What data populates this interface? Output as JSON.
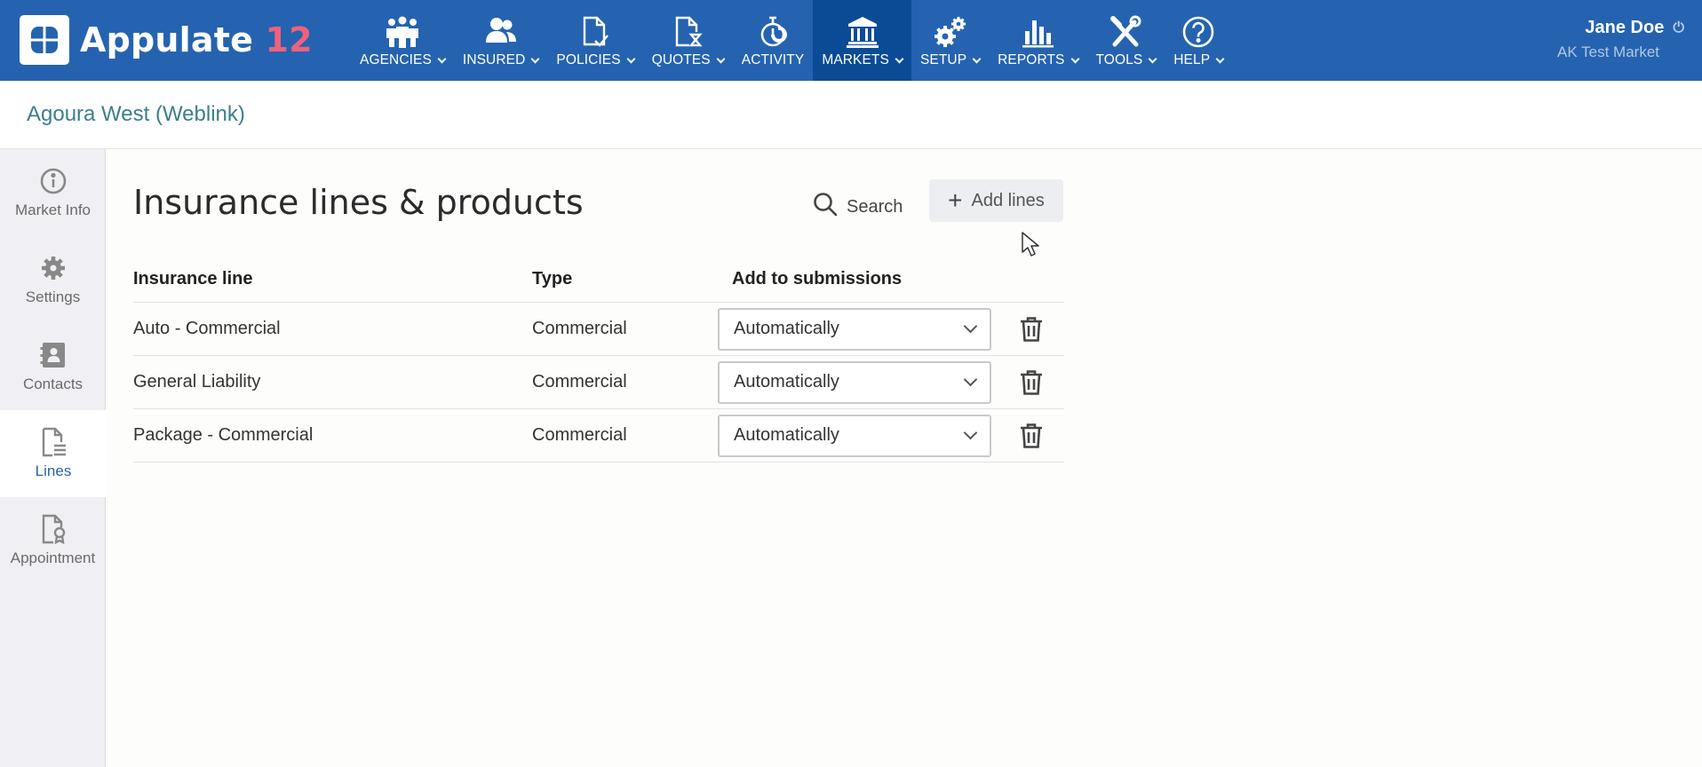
{
  "app": {
    "name": "Appulate",
    "version": "12"
  },
  "nav": {
    "items": [
      {
        "label": "AGENCIES",
        "icon": "agencies-icon",
        "has_menu": true
      },
      {
        "label": "INSURED",
        "icon": "insured-icon",
        "has_menu": true
      },
      {
        "label": "POLICIES",
        "icon": "policies-icon",
        "has_menu": true
      },
      {
        "label": "QUOTES",
        "icon": "quotes-icon",
        "has_menu": true
      },
      {
        "label": "ACTIVITY",
        "icon": "activity-icon",
        "has_menu": false
      },
      {
        "label": "MARKETS",
        "icon": "markets-icon",
        "has_menu": true,
        "active": true
      },
      {
        "label": "SETUP",
        "icon": "setup-icon",
        "has_menu": true
      },
      {
        "label": "REPORTS",
        "icon": "reports-icon",
        "has_menu": true
      },
      {
        "label": "TOOLS",
        "icon": "tools-icon",
        "has_menu": true
      },
      {
        "label": "HELP",
        "icon": "help-icon",
        "has_menu": true
      }
    ]
  },
  "user": {
    "name": "Jane Doe",
    "market": "AK Test Market"
  },
  "subheader": {
    "title": "Agoura West (Weblink)"
  },
  "sidebar": {
    "items": [
      {
        "label": "Market Info",
        "icon": "info-icon"
      },
      {
        "label": "Settings",
        "icon": "gear-icon"
      },
      {
        "label": "Contacts",
        "icon": "contacts-icon"
      },
      {
        "label": "Lines",
        "icon": "document-lines-icon",
        "active": true
      },
      {
        "label": "Appointment",
        "icon": "certificate-icon"
      }
    ]
  },
  "main": {
    "title": "Insurance lines & products",
    "search_label": "Search",
    "add_label": "Add lines",
    "table": {
      "headers": [
        "Insurance line",
        "Type",
        "Add to submissions"
      ],
      "rows": [
        {
          "line": "Auto - Commercial",
          "type": "Commercial",
          "submission": "Automatically"
        },
        {
          "line": "General Liability",
          "type": "Commercial",
          "submission": "Automatically"
        },
        {
          "line": "Package - Commercial",
          "type": "Commercial",
          "submission": "Automatically"
        }
      ]
    }
  },
  "colors": {
    "topbar": "#2563b0",
    "topbar_active": "#0b4b96",
    "accent_version": "#f0617e",
    "subheader_title": "#3b7f8a"
  }
}
